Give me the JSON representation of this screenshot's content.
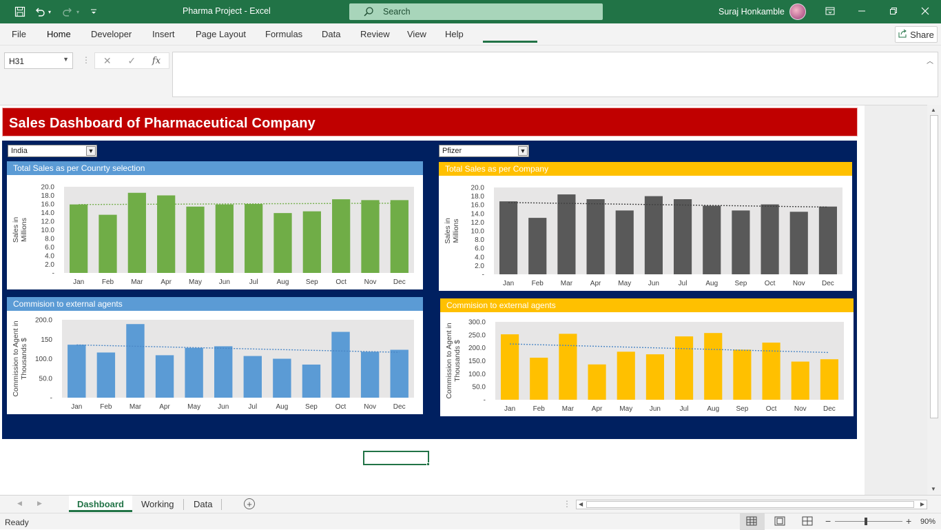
{
  "window": {
    "title": "Pharma Project  -  Excel",
    "search_placeholder": "Search",
    "user_name": "Suraj Honkamble"
  },
  "ribbon": {
    "tabs": [
      "File",
      "Home",
      "Developer",
      "Insert",
      "Page Layout",
      "Formulas",
      "Data",
      "Review",
      "View",
      "Help"
    ],
    "active_tab": "Home",
    "share_label": "Share"
  },
  "formula_bar": {
    "name_box": "H31",
    "formula": ""
  },
  "dashboard": {
    "title": "Sales Dashboard of Pharmaceutical Company",
    "country_select": "India",
    "company_select": "Pfizer"
  },
  "colors": {
    "excel_green": "#217346",
    "title_red": "#c00000",
    "navy": "#002060",
    "panel_blue_head": "#5b9bd5",
    "panel_gold_head": "#ffc000",
    "green_bar": "#70ad47",
    "grey_bar": "#595959",
    "blue_bar": "#5b9bd5",
    "gold_bar": "#ffc000"
  },
  "chart_data": [
    {
      "id": "country-sales",
      "type": "bar",
      "title": "Total Sales as per Counrty selection",
      "ylabel": "Sales in Millions",
      "categories": [
        "Jan",
        "Feb",
        "Mar",
        "Apr",
        "May",
        "Jun",
        "Jul",
        "Aug",
        "Sep",
        "Oct",
        "Nov",
        "Dec"
      ],
      "values": [
        15.9,
        13.5,
        18.6,
        18.0,
        15.4,
        15.9,
        16.0,
        13.9,
        14.3,
        17.1,
        16.9,
        16.9
      ],
      "yticks": [
        "20.0",
        "18.0",
        "16.0",
        "14.0",
        "12.0",
        "10.0",
        "8.0",
        "6.0",
        "4.0",
        "2.0",
        "-"
      ],
      "ylim": [
        0,
        20
      ],
      "trendline": true,
      "color": "#70ad47",
      "trend_color": "#70ad47"
    },
    {
      "id": "company-sales",
      "type": "bar",
      "title": "Total Sales as per Company",
      "ylabel": "Sales in Millions",
      "categories": [
        "Jan",
        "Feb",
        "Mar",
        "Apr",
        "May",
        "Jun",
        "Jul",
        "Aug",
        "Sep",
        "Oct",
        "Nov",
        "Dec"
      ],
      "values": [
        16.8,
        13.0,
        18.4,
        17.3,
        14.7,
        18.0,
        17.3,
        15.8,
        14.7,
        16.1,
        14.4,
        15.6
      ],
      "yticks": [
        "20.0",
        "18.0",
        "16.0",
        "14.0",
        "12.0",
        "10.0",
        "8.0",
        "6.0",
        "4.0",
        "2.0",
        "-"
      ],
      "ylim": [
        0,
        20
      ],
      "trendline": true,
      "color": "#595959",
      "trend_color": "#404040"
    },
    {
      "id": "country-commission",
      "type": "bar",
      "title": "Commision to external agents",
      "ylabel": "Commission to Agent in Thousands $",
      "categories": [
        "Jan",
        "Feb",
        "Mar",
        "Apr",
        "May",
        "Jun",
        "Jul",
        "Aug",
        "Sep",
        "Oct",
        "Nov",
        "Dec"
      ],
      "values": [
        136,
        116,
        189,
        109,
        128,
        132,
        107,
        100,
        85,
        169,
        118,
        123
      ],
      "yticks": [
        "200.0",
        "150",
        "100.0",
        "50.0",
        "-"
      ],
      "ylim": [
        0,
        200
      ],
      "trendline": true,
      "color": "#5b9bd5",
      "trend_color": "#4a86c5"
    },
    {
      "id": "company-commission",
      "type": "bar",
      "title": "Commision to external agents",
      "ylabel": "Commission to Agent in Thousands $",
      "categories": [
        "Jan",
        "Feb",
        "Mar",
        "Apr",
        "May",
        "Jun",
        "Jul",
        "Aug",
        "Sep",
        "Oct",
        "Nov",
        "Dec"
      ],
      "values": [
        252,
        162,
        254,
        136,
        185,
        175,
        244,
        257,
        193,
        220,
        147,
        156
      ],
      "yticks": [
        "300.0",
        "250.0",
        "200.0",
        "150.0",
        "100.0",
        "50.0",
        "-"
      ],
      "ylim": [
        0,
        300
      ],
      "trendline": true,
      "color": "#ffc000",
      "trend_color": "#4a86c5"
    }
  ],
  "sheet_tabs": [
    "Dashboard",
    "Working",
    "Data"
  ],
  "active_sheet": "Dashboard",
  "status": {
    "ready": "Ready",
    "zoom": "90%"
  }
}
